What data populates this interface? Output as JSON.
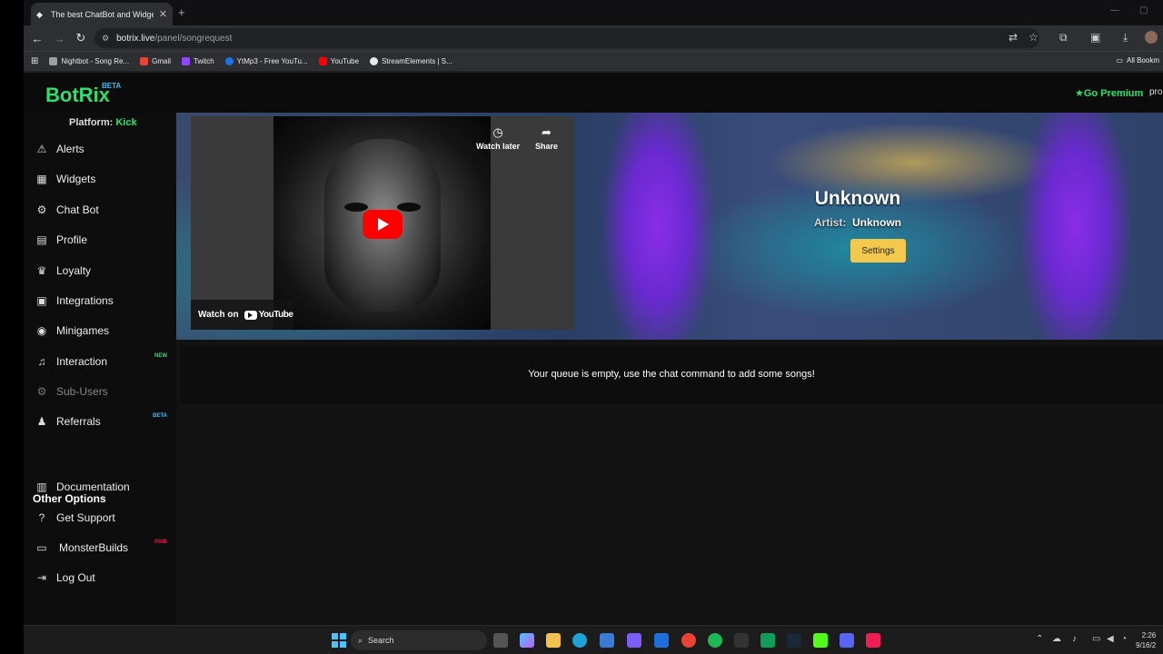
{
  "browser": {
    "tab_title": "The best ChatBot and Widgets",
    "url_host": "botrix.live",
    "url_path": "/panel/songrequest",
    "bookmarks": [
      {
        "label": "Nightbot - Song Re...",
        "color": "#9e9e9e"
      },
      {
        "label": "Gmail",
        "color": "#ea4335"
      },
      {
        "label": "Twitch",
        "color": "#9146ff"
      },
      {
        "label": "YtMp3 - Free YouTu...",
        "color": "#1a73e8"
      },
      {
        "label": "YouTube",
        "color": "#ff0000"
      },
      {
        "label": "StreamElements | S...",
        "color": "#e8e8e8"
      }
    ],
    "all_bookmarks": "All Bookm"
  },
  "header": {
    "logo": "BotRix",
    "beta": "BETA",
    "premium": "Go Premium",
    "profile": "pro"
  },
  "sidebar": {
    "platform_label": "Platform:",
    "platform_value": "Kick",
    "items": [
      {
        "label": "Alerts",
        "icon": "warning-icon"
      },
      {
        "label": "Widgets",
        "icon": "grid-icon"
      },
      {
        "label": "Chat Bot",
        "icon": "robot-icon"
      },
      {
        "label": "Profile",
        "icon": "id-card-icon"
      },
      {
        "label": "Loyalty",
        "icon": "trophy-icon"
      },
      {
        "label": "Integrations",
        "icon": "plug-icon"
      },
      {
        "label": "Minigames",
        "icon": "gamepad-icon"
      },
      {
        "label": "Interaction",
        "icon": "music-icon",
        "badge": "NEW",
        "badge_color": "#2ee06b"
      },
      {
        "label": "Sub-Users",
        "icon": "users-cog-icon"
      },
      {
        "label": "Referrals",
        "icon": "users-icon",
        "badge": "BETA",
        "badge_color": "#38bdf8"
      }
    ],
    "other_options_title": "Other Options",
    "other_items": [
      {
        "label": "Documentation",
        "icon": "book-icon"
      },
      {
        "label": "Get Support",
        "icon": "question-icon"
      },
      {
        "label": "MonsterBuilds",
        "icon": "laptop-icon",
        "badge": "PAID",
        "badge_color": "#e11d48"
      },
      {
        "label": "Log Out",
        "icon": "logout-icon"
      }
    ]
  },
  "player": {
    "watch_later": "Watch later",
    "share": "Share",
    "watch_on": "Watch on",
    "youtube": "YouTube"
  },
  "song": {
    "title": "Unknown",
    "artist_label": "Artist:",
    "artist_value": "Unknown",
    "settings": "Settings"
  },
  "queue": {
    "empty_message": "Your queue is empty, use the chat command to add some songs!"
  },
  "taskbar": {
    "search": "Search",
    "time": "2:26",
    "date": "9/16/2"
  }
}
